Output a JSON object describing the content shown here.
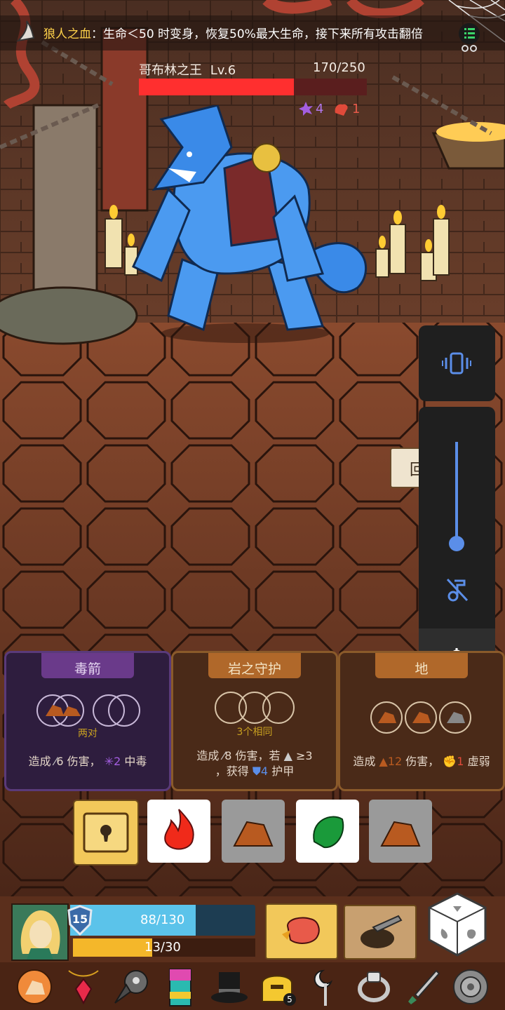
{
  "banner": {
    "title": "狼人之血",
    "separator": "：",
    "text": "生命＜50 时变身，恢复50%最大生命，接下来所有攻击翻倍"
  },
  "enemy": {
    "name": "哥布林之王",
    "level": "Lv.6",
    "hp_text": "170/250",
    "hp_fraction": 0.68,
    "status": [
      {
        "icon": "poison-splat-icon",
        "count": "4",
        "color": "#a35ee0"
      },
      {
        "icon": "weak-fist-icon",
        "count": "1",
        "color": "#e04a3a"
      }
    ]
  },
  "side_button": {
    "label": "回"
  },
  "cards": [
    {
      "title": "毒箭",
      "condition": "两对",
      "desc_pre": "造成",
      "desc_num": "6",
      "desc_mid": "伤害，",
      "desc_num2": "2",
      "desc_post": "中毒"
    },
    {
      "title": "岩之守护",
      "condition": "3个相同",
      "line1_pre": "造成",
      "line1_num": "8",
      "line1_mid": "伤害，若",
      "line1_post": "≥3",
      "line2_pre": "，获得",
      "line2_num": "4",
      "line2_post": "护甲"
    },
    {
      "title": "地",
      "desc_pre": "造成",
      "desc_num": "12",
      "desc_mid": "伤害，",
      "desc_num2": "1",
      "desc_post": "虚弱"
    }
  ],
  "dice": [
    "locked-chest-icon",
    "fire-icon",
    "rock-icon",
    "leaf-icon",
    "rock-icon"
  ],
  "player": {
    "level": "15",
    "hp_text": "88/130",
    "hp_fraction": 0.677,
    "xp_text": "13/30",
    "xp_fraction": 0.433
  },
  "actions": [
    "fist-attack-icon",
    "dig-shovel-icon",
    "roll-dice-icon"
  ],
  "items": [
    {
      "icon": "orange-rock-icon"
    },
    {
      "icon": "red-gem-amulet-icon"
    },
    {
      "icon": "plague-mask-icon"
    },
    {
      "icon": "totem-icon"
    },
    {
      "icon": "top-hat-icon"
    },
    {
      "icon": "golden-helmet-icon",
      "badge": "5"
    },
    {
      "icon": "moon-wand-icon"
    },
    {
      "icon": "silver-ring-icon"
    },
    {
      "icon": "dagger-icon"
    },
    {
      "icon": "round-shield-icon"
    }
  ]
}
